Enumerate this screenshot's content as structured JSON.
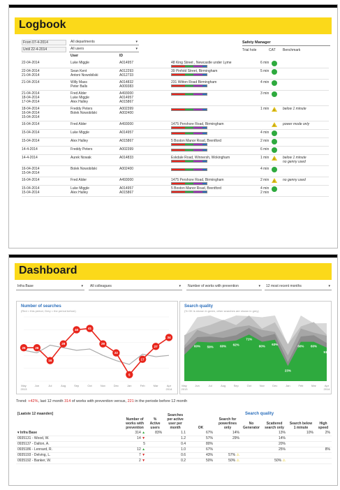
{
  "logbook": {
    "title": "Logbook",
    "from_label": "From 07-4-2014",
    "until_label": "Until 22-4-2014",
    "dept_select": "All departments",
    "users_select": "All users",
    "col_user": "User",
    "col_id": "ID",
    "col_safety": "Safety Manager",
    "col_trial": "Trial hole",
    "col_cat": "CAT",
    "col_bench": "Benchmark",
    "rows": [
      {
        "date": "22-04-2014",
        "user": "Luke Miggle",
        "id": "A014957",
        "addr": "48 King Street , Newcastle under Lyme",
        "time": "6 min",
        "status": "ok",
        "note": ""
      },
      {
        "date": "22-04-2014\n21-04-2014",
        "user": "Sean Kent\nAntoni Nowobilski",
        "id": "A012293\nA012733",
        "addr": "39 Pinfold Street, Birmingham",
        "time": "5 min",
        "status": "ok",
        "note": ""
      },
      {
        "date": "21-04-2014",
        "user": "Willy Mass\nPeter Balls",
        "id": "A014832\nA009383",
        "addr": "231 Witton Road Birmingham",
        "time": "4 min",
        "status": "ok",
        "note": ""
      },
      {
        "date": "21-04-2014\n18-04-2014\n17-04-2014",
        "user": "Fred Alder\nLuke Miggle\nAlex Halley",
        "id": "A493000\nA014957\nA015867",
        "addr": "",
        "time": "3 min",
        "status": "ok",
        "note": ""
      },
      {
        "date": "18-04-2014\n16-04-2014\n15-04-2014",
        "user": "Freddy Peters\nBolek Nowobilski",
        "id": "A002399\nA002400",
        "addr": "",
        "time": "1 min",
        "status": "warn",
        "note": "below 1 minute"
      },
      {
        "date": "16-04-2014",
        "user": "Fred Alder",
        "id": "A493000",
        "addr": "1475 Pershore Road, Birmingham",
        "time": "",
        "status": "warn",
        "note": "power mode only"
      },
      {
        "date": "15-04-2014",
        "user": "Luke Miggle",
        "id": "A014957",
        "addr": "",
        "time": "4 min",
        "status": "ok",
        "note": ""
      },
      {
        "date": "15-04-2014",
        "user": "Alex Halley",
        "id": "A015867",
        "addr": "5 Boston Manor Road, Brentford",
        "time": "2 min",
        "status": "ok",
        "note": ""
      },
      {
        "date": "14-4-2014",
        "user": "Freddy Peters",
        "id": "A002399",
        "addr": "",
        "time": "6 min",
        "status": "ok",
        "note": ""
      },
      {
        "date": "14-4-2014",
        "user": "Aurek Nowak",
        "id": "A014833",
        "addr": "Eskdale Road, Winnersh, Wokingham",
        "time": "1 min",
        "status": "warn",
        "note": "below 1 minute\nno genny used"
      },
      {
        "date": "16-04-2014\n15-04-2014",
        "user": "Bolek Nowobilski",
        "id": "A002400",
        "addr": "",
        "time": "4 min",
        "status": "ok",
        "note": ""
      },
      {
        "date": "16-04-2014",
        "user": "Fred Alder",
        "id": "A493000",
        "addr": "1475 Pershore Road, Birmingham",
        "time": "2 min",
        "status": "warn",
        "note": "no genny used"
      },
      {
        "date": "15-04-2014\n15-04-2014",
        "user": "Luke Miggle\nAlex Halley",
        "id": "A014957\nA015867",
        "addr": "5 Boston Manor Road, Brentford",
        "time": "4 min\n2 min",
        "status": "ok",
        "note": ""
      }
    ]
  },
  "dashboard": {
    "title": "Dashboard",
    "filters": [
      "Infra Base",
      "All colleagues",
      "Number of works with prevention",
      "12 most recent months"
    ],
    "searches_title": "Number of searches",
    "searches_sub": "(Red = this period, Grey = the period before)",
    "quality_title": "Search quality",
    "quality_sub": "(% OK is shown in green, other searches are shown in grey)",
    "trend_prefix": "Trend: ",
    "trend_pct": "+42%",
    "trend_mid": ", last 12 month ",
    "trend_n1": "314",
    "trend_mid2": " of works with prevention versus, ",
    "trend_n2": "221",
    "trend_suffix": " in the periode before 12 month",
    "table_period": "[Laatste 12 maanden]",
    "table_headers": [
      "Number of works with prevention",
      "% Active users",
      "Searches per active user per month",
      "OK",
      "Search for powerlines only",
      "No Generator",
      "Scattered search only",
      "Search below 1 minute",
      "High speed"
    ],
    "table_group": "Search quality",
    "table_rows": [
      {
        "name": "▾ Infra Base",
        "n": "314",
        "trend": "up",
        "act": "83%",
        "spu": "1.1",
        "ok": "67%",
        "pw": "14%",
        "gen": "",
        "sc": "13%",
        "below": "10%",
        "hs": "2%"
      },
      {
        "name": "0935131 - Wood, W.",
        "n": "14",
        "trend": "dn",
        "act": "",
        "spu": "1.2",
        "ok": "57%",
        "pw": "29%",
        "gen": "",
        "sc": "14%",
        "below": "",
        "hs": ""
      },
      {
        "name": "0935137 - Dalton, A.",
        "n": "5",
        "trend": "",
        "act": "",
        "spu": "0.4",
        "ok": "80%",
        "pw": "",
        "gen": "",
        "sc": "20%",
        "below": "",
        "hs": ""
      },
      {
        "name": "0935186 - Lennard, R.",
        "n": "12",
        "trend": "up",
        "act": "",
        "spu": "1.0",
        "ok": "67%",
        "pw": "",
        "gen": "",
        "sc": "25%",
        "below": "",
        "hs": "8%"
      },
      {
        "name": "0935193 - Delving, L.",
        "n": "7",
        "trend": "dn",
        "act": "",
        "spu": "0.6",
        "ok": "43%",
        "pw": "57%",
        "gen": "",
        "sc": "",
        "below": "",
        "hs": ""
      },
      {
        "name": "0935192 - Banker, W.",
        "n": "2",
        "trend": "dn",
        "act": "",
        "spu": "0.2",
        "ok": "50%",
        "pw": "50%",
        "gen": "",
        "sc": "50%",
        "below": "",
        "hs": ""
      }
    ]
  },
  "chart_data": [
    {
      "type": "line",
      "title": "Number of searches",
      "subtitle": "(Red = this period, Grey = the period before)",
      "categories": [
        "May 2013",
        "Jun",
        "Jul",
        "Aug",
        "Sep",
        "Oct",
        "Nov",
        "Dec",
        "Jan",
        "Feb",
        "Mar",
        "Apr 2014"
      ],
      "series": [
        {
          "name": "this period",
          "values": [
            26,
            26,
            16,
            29,
            40,
            41,
            29,
            22,
            5,
            17,
            27,
            34
          ]
        },
        {
          "name": "the period before",
          "values": [
            24,
            22,
            28,
            26,
            24,
            25,
            20,
            16,
            13,
            21,
            19,
            20
          ]
        }
      ],
      "ylim": [
        0,
        50
      ]
    },
    {
      "type": "area",
      "title": "Search quality",
      "subtitle": "(% OK is shown in green, other searches are shown in grey)",
      "categories": [
        "May 2013",
        "Jun",
        "Jul",
        "Aug",
        "Sep",
        "Oct",
        "Nov",
        "Dec",
        "Jan",
        "Feb",
        "Mar",
        "Apr 2014"
      ],
      "series": [
        {
          "name": "% OK",
          "values": [
            40,
            60,
            59,
            60,
            62,
            71,
            60,
            63,
            23,
            60,
            60,
            51
          ]
        }
      ],
      "ylim": [
        0,
        100
      ]
    }
  ],
  "colors": {
    "accent": "#fbd91a",
    "ok": "#2eaa3e",
    "warn": "#e3c21a",
    "red": "#e8251b",
    "blue": "#2a6ebb"
  }
}
